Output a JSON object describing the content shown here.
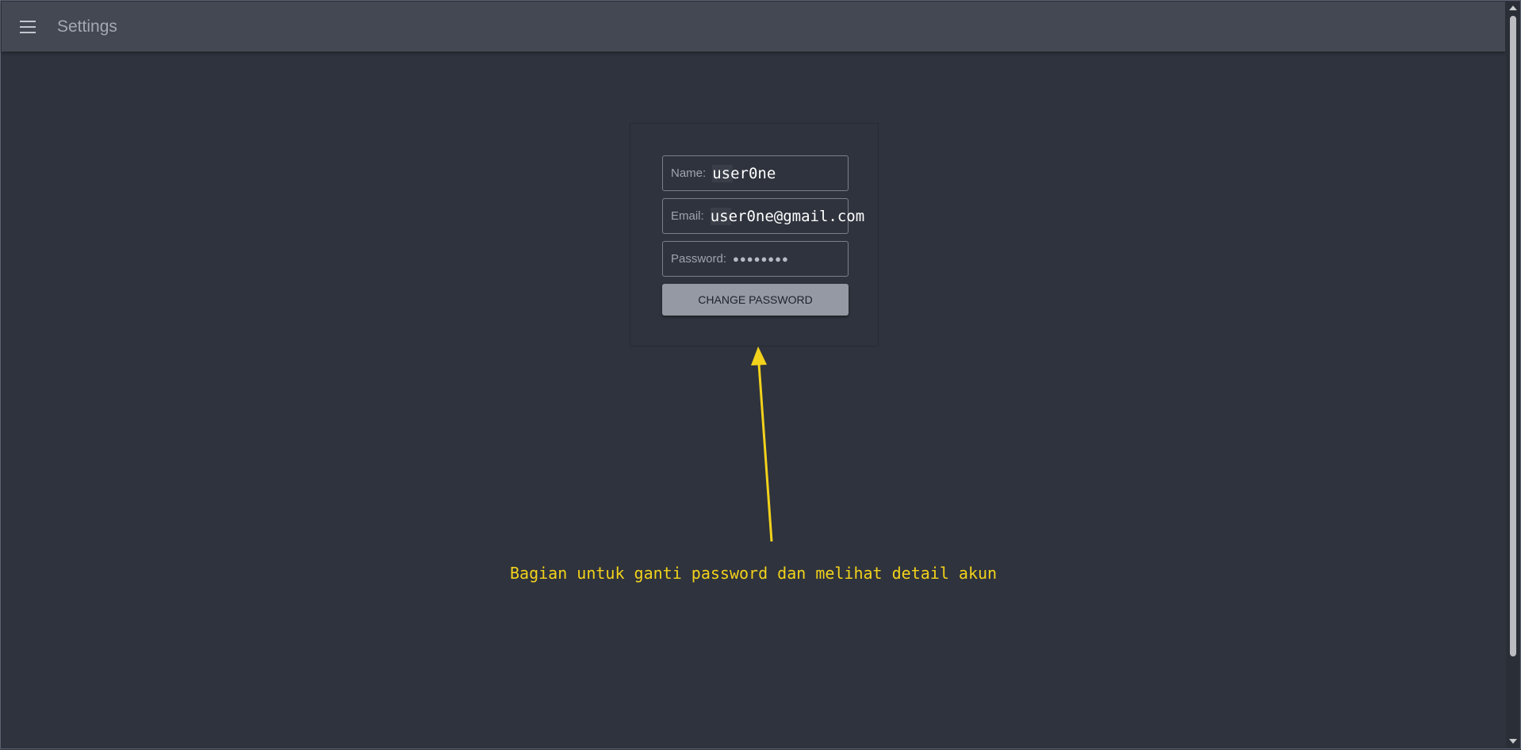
{
  "appbar": {
    "title": "Settings",
    "menu_icon": "hamburger-menu-icon"
  },
  "account": {
    "name_label": "Name:",
    "name_value": "user0ne",
    "email_label": "Email:",
    "email_value": "user0ne@gmail.com",
    "password_label": "Password:",
    "password_value": "●●●●●●●●",
    "change_password_label": "CHANGE PASSWORD"
  },
  "annotation": {
    "text": "Bagian untuk ganti password dan melihat detail akun",
    "color": "#f2d21b"
  },
  "colors": {
    "background": "#2f333d",
    "appbar": "#444852",
    "button": "#9499a3"
  }
}
